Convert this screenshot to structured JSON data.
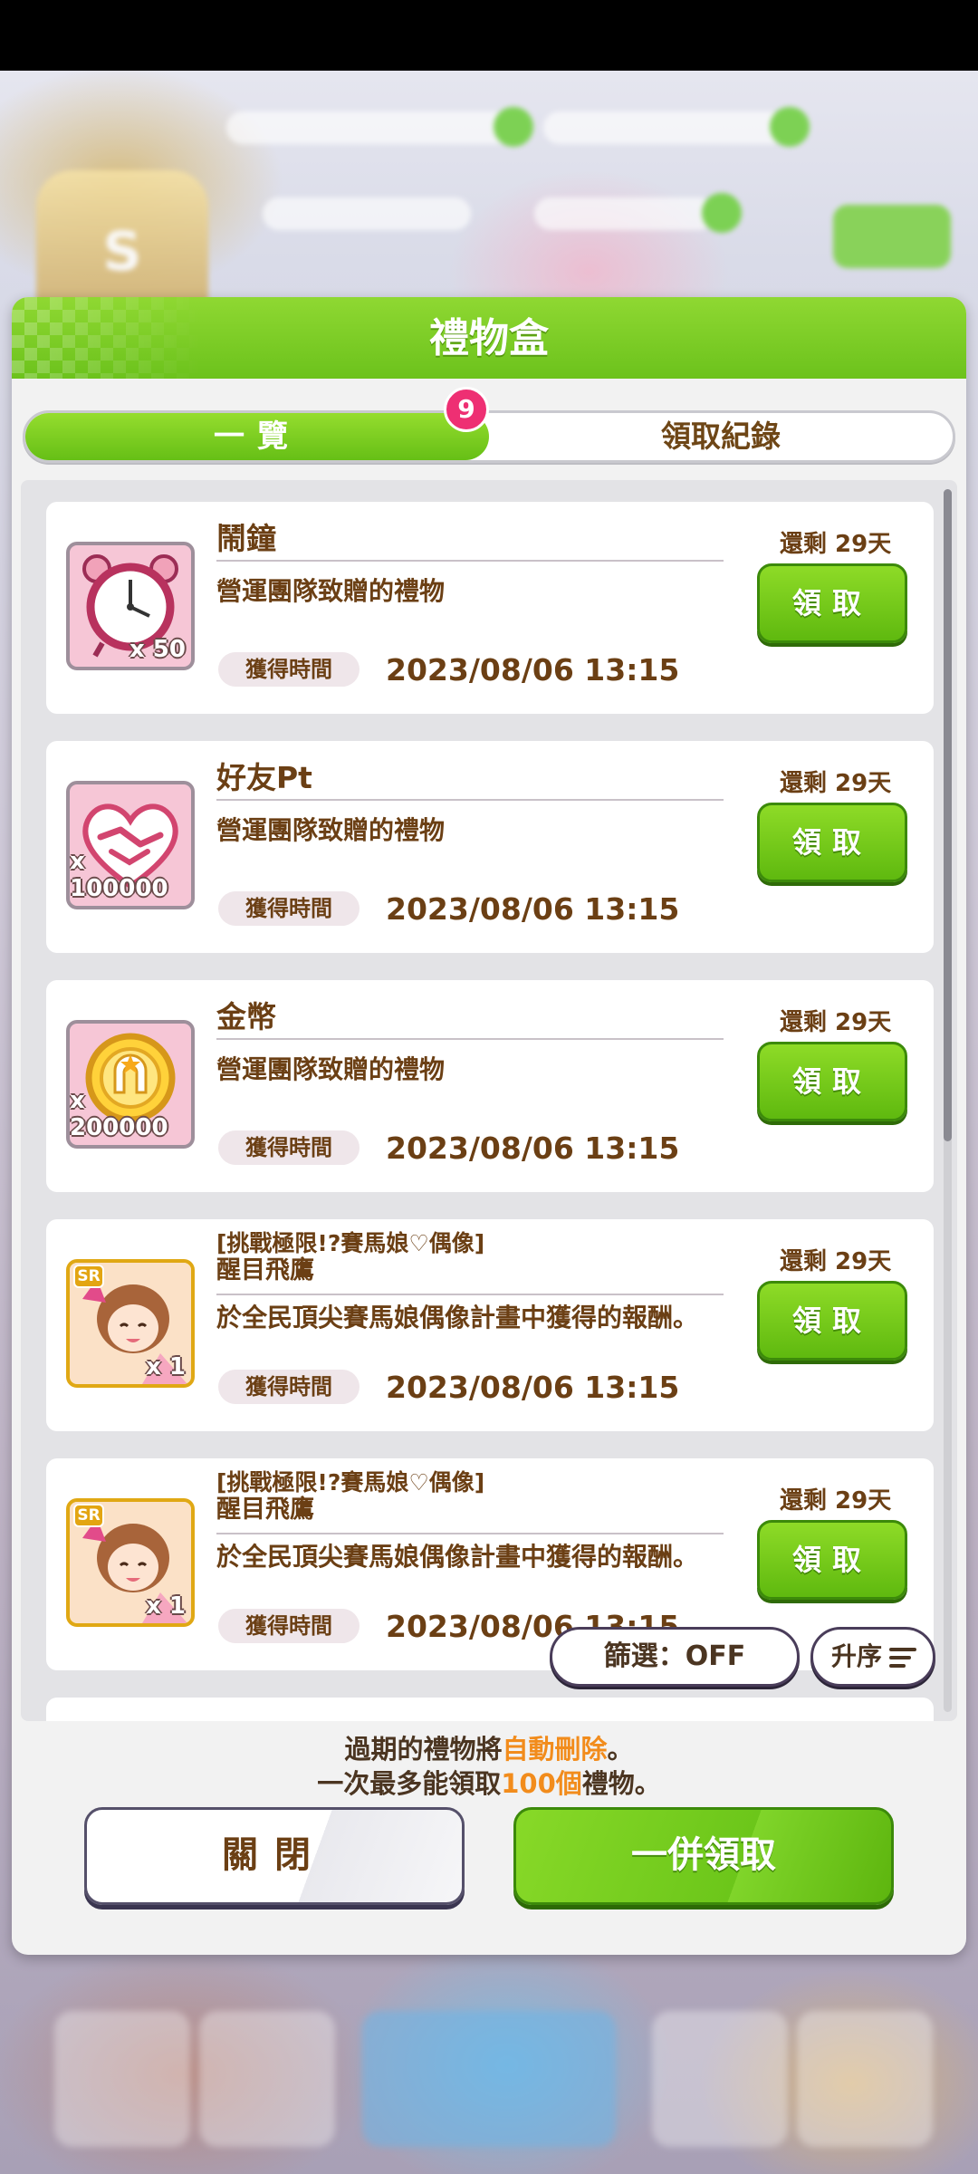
{
  "modal": {
    "title": "禮物盒",
    "tabs": {
      "active": "一覽",
      "inactive": "領取紀錄",
      "badge": "9"
    },
    "filter_label": "篩選：OFF",
    "sort_label": "升序",
    "notice_line1_pre": "過期的禮物將",
    "notice_line1_hl": "自動刪除",
    "notice_line1_post": "。",
    "notice_line2_pre": "一次最多能領取",
    "notice_line2_hl": "100個",
    "notice_line2_post": "禮物。",
    "close_label": "關閉",
    "claim_all_label": "一併領取"
  },
  "items": [
    {
      "icon": "alarm-clock-icon",
      "name": "鬧鐘",
      "qty": "x 50",
      "desc": "營運團隊致贈的禮物",
      "time_label": "獲得時間",
      "time": "2023/08/06 13:15",
      "remain": "還剩 29天",
      "claim": "領取"
    },
    {
      "icon": "handshake-heart-icon",
      "name": "好友Pt",
      "qty": "x 100000",
      "desc": "營運團隊致贈的禮物",
      "time_label": "獲得時間",
      "time": "2023/08/06 13:15",
      "remain": "還剩 29天",
      "claim": "領取"
    },
    {
      "icon": "gold-coin-icon",
      "name": "金幣",
      "qty": "x 200000",
      "desc": "營運團隊致贈的禮物",
      "time_label": "獲得時間",
      "time": "2023/08/06 13:15",
      "remain": "還剩 29天",
      "claim": "領取"
    },
    {
      "icon": "sr-support-card-icon",
      "subtitle": "[挑戰極限!?賽馬娘♡偶像]",
      "name": "醒目飛鷹",
      "rarity": "SR",
      "qty": "x 1",
      "desc": "於全民頂尖賽馬娘偶像計畫中獲得的報酬。",
      "time_label": "獲得時間",
      "time": "2023/08/06 13:15",
      "remain": "還剩 29天",
      "claim": "領取"
    },
    {
      "icon": "sr-support-card-icon",
      "subtitle": "[挑戰極限!?賽馬娘♡偶像]",
      "name": "醒目飛鷹",
      "rarity": "SR",
      "qty": "x 1",
      "desc": "於全民頂尖賽馬娘偶像計畫中獲得的報酬。",
      "time_label": "獲得時間",
      "time": "2023/08/06 13:15",
      "remain": "還剩 29天",
      "claim": "領取"
    }
  ],
  "colors": {
    "accent_green": "#6cc21c",
    "text_brown": "#6b3f14",
    "badge_pink": "#ee2f73",
    "highlight_orange": "#f28c1c"
  }
}
